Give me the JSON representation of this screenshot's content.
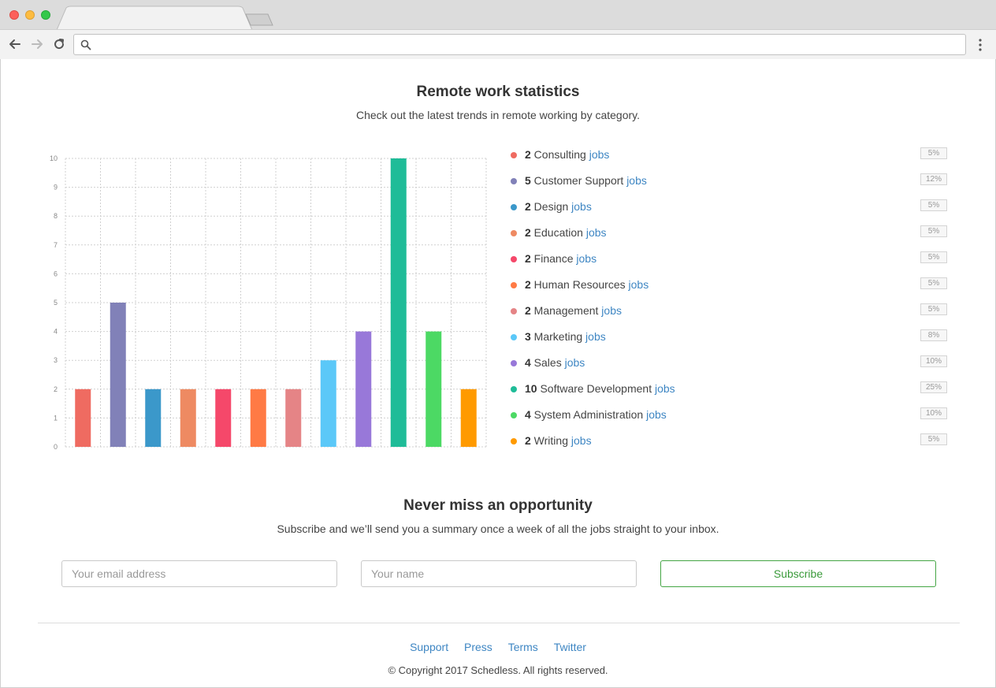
{
  "browser": {
    "url": "",
    "icons": [
      "back-arrow-icon",
      "forward-arrow-icon",
      "reload-icon",
      "search-icon",
      "menu-dots-icon"
    ]
  },
  "stats": {
    "title": "Remote work statistics",
    "subtitle": "Check out the latest trends in remote working by category.",
    "link_word": "jobs"
  },
  "chart_data": {
    "type": "bar",
    "categories": [
      "Consulting",
      "Customer Support",
      "Design",
      "Education",
      "Finance",
      "Human Resources",
      "Management",
      "Marketing",
      "Sales",
      "Software Development",
      "System Administration",
      "Writing"
    ],
    "values": [
      2,
      5,
      2,
      2,
      2,
      2,
      2,
      3,
      4,
      10,
      4,
      2
    ],
    "colors": [
      "#ef6b61",
      "#8181b8",
      "#3b98ca",
      "#ee8a62",
      "#f5486a",
      "#ff7a45",
      "#e58486",
      "#5bc8f8",
      "#9878d9",
      "#1fbc98",
      "#4cd964",
      "#ff9a00"
    ],
    "percents": [
      "5%",
      "12%",
      "5%",
      "5%",
      "5%",
      "5%",
      "5%",
      "8%",
      "10%",
      "25%",
      "10%",
      "5%"
    ],
    "ylim": [
      0,
      10
    ],
    "yticks": [
      0,
      1,
      2,
      3,
      4,
      5,
      6,
      7,
      8,
      9,
      10
    ],
    "grid": true,
    "title": "",
    "xlabel": "",
    "ylabel": ""
  },
  "subscribe": {
    "title": "Never miss an opportunity",
    "subtitle": "Subscribe and we’ll send you a summary once a week of all the jobs straight to your inbox.",
    "email_placeholder": "Your email address",
    "name_placeholder": "Your name",
    "button_label": "Subscribe"
  },
  "footer": {
    "links": [
      "Support",
      "Press",
      "Terms",
      "Twitter"
    ],
    "copyright": "© Copyright 2017 Schedless. All rights reserved."
  }
}
